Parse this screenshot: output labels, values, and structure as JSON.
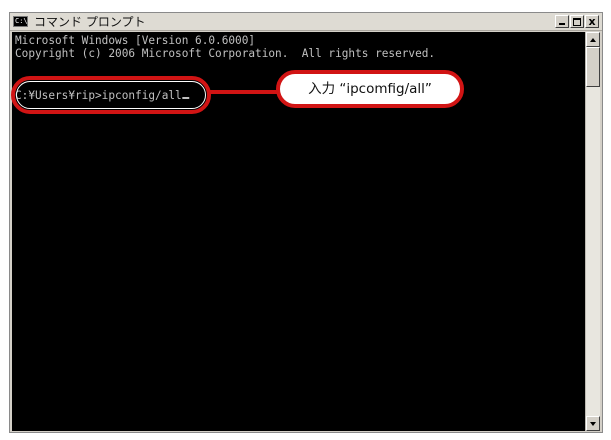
{
  "window": {
    "title": "コマンド プロンプト",
    "icon": "console-icon",
    "icon_text": "C:\\",
    "buttons": [
      "minimize",
      "maximize",
      "close"
    ],
    "close_glyph": "x"
  },
  "console": {
    "lines": [
      "Microsoft Windows [Version 6.0.6000]",
      "Copyright (c) 2006 Microsoft Corporation.  All rights reserved.",
      "",
      "C:¥Users¥rip>ipconfig/all"
    ],
    "text_color": "#c0c0c0",
    "background": "#000000"
  },
  "annotation": {
    "callout_text": "入力 “ipcomfig/all”",
    "color": "#d11414"
  }
}
